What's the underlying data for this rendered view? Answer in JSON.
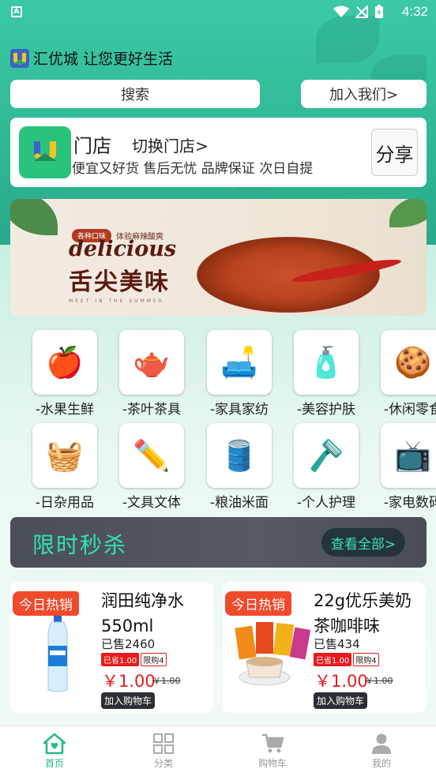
{
  "status_bar": {
    "time": "4:32",
    "left_icon": "A"
  },
  "brand": {
    "title": "汇优城 让您更好生活"
  },
  "search": {
    "label": "搜索"
  },
  "join": {
    "label": "加入我们>"
  },
  "store": {
    "title": "门店",
    "switch_label": "切换门店>",
    "slogan": "便宜又好货 售后无忧 品牌保证 次日自提",
    "share_label": "分享"
  },
  "banner": {
    "tag_left": "各种口味",
    "tag_right": "体验麻辣酸爽",
    "word": "delicious",
    "title": "舌尖美味",
    "subtitle": "MEET IN THE SUMMER"
  },
  "categories": [
    {
      "label": "-水果生鲜",
      "icon": "🍎"
    },
    {
      "label": "-茶叶茶具",
      "icon": "🫖"
    },
    {
      "label": "-家具家纺",
      "icon": "🛋️"
    },
    {
      "label": "-美容护肤",
      "icon": "🧴"
    },
    {
      "label": "-休闲零食",
      "icon": "🍪"
    },
    {
      "label": "-日杂用品",
      "icon": "🧺"
    },
    {
      "label": "-文具文体",
      "icon": "✏️"
    },
    {
      "label": "-粮油米面",
      "icon": "🛢️"
    },
    {
      "label": "-个人护理",
      "icon": "🪒"
    },
    {
      "label": "-家电数码",
      "icon": "📺"
    }
  ],
  "flash_sale": {
    "title": "限时秒杀",
    "more_label": "查看全部>"
  },
  "products": [
    {
      "hot": "今日热销",
      "name": "润田纯净水550ml",
      "sold": "已售2460",
      "save": "已省1.00",
      "limit": "限购4",
      "price": "￥1.00",
      "orig": "￥1.00",
      "cart": "加入购物车",
      "icon": "water-bottle-icon"
    },
    {
      "hot": "今日热销",
      "name": "22g优乐美奶茶咖啡味",
      "sold": "已售434",
      "save": "已省1.00",
      "limit": "限购4",
      "price": "￥1.00",
      "orig": "￥1.00",
      "cart": "加入购物车",
      "icon": "milk-tea-icon"
    }
  ],
  "tabbar": [
    {
      "label": "首页",
      "icon": "home-icon",
      "active": true
    },
    {
      "label": "分类",
      "icon": "grid-icon",
      "active": false
    },
    {
      "label": "购物车",
      "icon": "cart-icon",
      "active": false
    },
    {
      "label": "我的",
      "icon": "user-icon",
      "active": false
    }
  ],
  "colors": {
    "accent": "#26b98c",
    "price": "#e61b1b",
    "hot": "#ef4a2a",
    "flash_text": "#2fe3b4"
  }
}
